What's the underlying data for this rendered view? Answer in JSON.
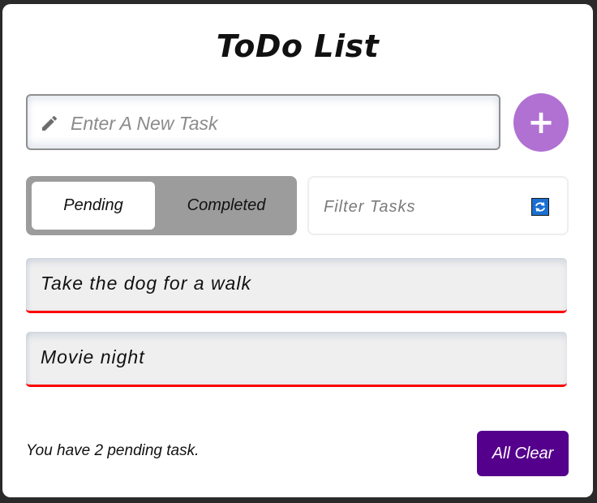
{
  "app": {
    "title": "ToDo List"
  },
  "new_task": {
    "placeholder": "Enter A New Task",
    "value": "",
    "add_label": "+"
  },
  "tabs": {
    "pending_label": "Pending",
    "completed_label": "Completed",
    "selected": "Pending"
  },
  "filter": {
    "placeholder": "Filter Tasks",
    "value": ""
  },
  "tasks": [
    {
      "text": "Take the dog for a walk"
    },
    {
      "text": "Movie night"
    }
  ],
  "footer": {
    "status_text": "You have 2 pending task.",
    "clear_label": "All Clear"
  },
  "icons": {
    "input": "pencil-icon",
    "filter": "refresh-icon"
  },
  "colors": {
    "add_button": "#b071d3",
    "clear_button": "#55008c",
    "task_underline": "#ff0000",
    "refresh_icon": "#1a6fd1"
  }
}
